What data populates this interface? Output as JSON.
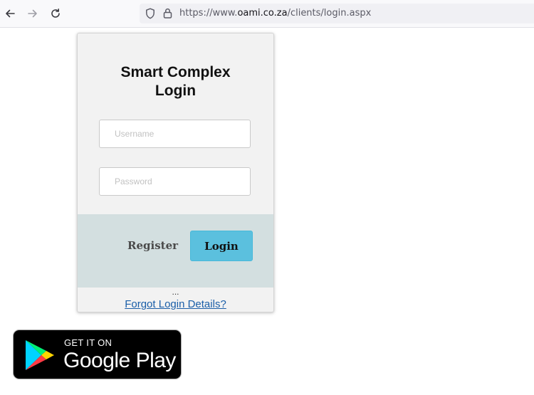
{
  "browser": {
    "url_scheme": "https://www.",
    "url_domain": "oami.co.za",
    "url_path": "/clients/login.aspx"
  },
  "login": {
    "title_line1": "Smart Complex",
    "title_line2": "Login",
    "username_placeholder": "Username",
    "password_placeholder": "Password",
    "register_label": "Register",
    "login_label": "Login",
    "dots": "...",
    "forgot_label": "Forgot Login Details?"
  },
  "colors": {
    "accent": "#5bc0de",
    "band": "#d3dfe0",
    "link": "#1a5ea8"
  },
  "store_badge": {
    "line1": "GET IT ON",
    "line2": "Google Play",
    "icon": "google-play-logo"
  },
  "icons": {
    "back": "back-arrow-icon",
    "forward": "forward-arrow-icon",
    "reload": "reload-icon",
    "shield": "shield-icon",
    "lock": "lock-icon"
  }
}
